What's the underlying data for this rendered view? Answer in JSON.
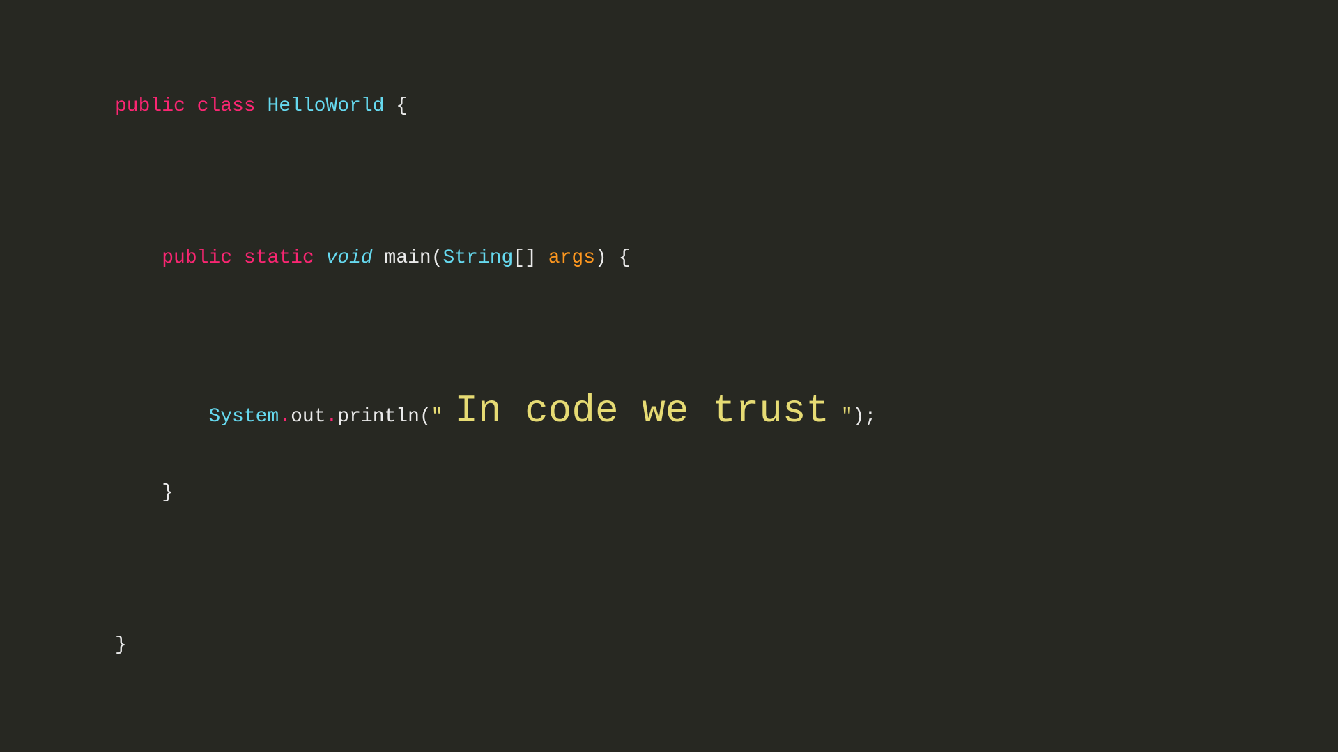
{
  "code": {
    "line1": {
      "public": "public",
      "class": "class",
      "classname": "HelloWorld",
      "brace_open": " {"
    },
    "line2": "",
    "line3": {
      "indent": "    ",
      "public": "public",
      "static": "static",
      "void": "void",
      "main": " main(",
      "string": "String",
      "brackets": "[] ",
      "args": "args",
      "close": ") {"
    },
    "line4": "",
    "line5": {
      "indent": "        ",
      "system": "System",
      "dot1": ".",
      "out": "out",
      "dot2": ".",
      "println": "println(",
      "quote1": "\"",
      "space1": " ",
      "big_text": "In code we trust",
      "space2": " ",
      "quote2": "\"",
      "close": ");"
    },
    "line6": {
      "indent": "    ",
      "brace": "}"
    },
    "line7": "",
    "line8": {
      "brace": "}"
    }
  }
}
